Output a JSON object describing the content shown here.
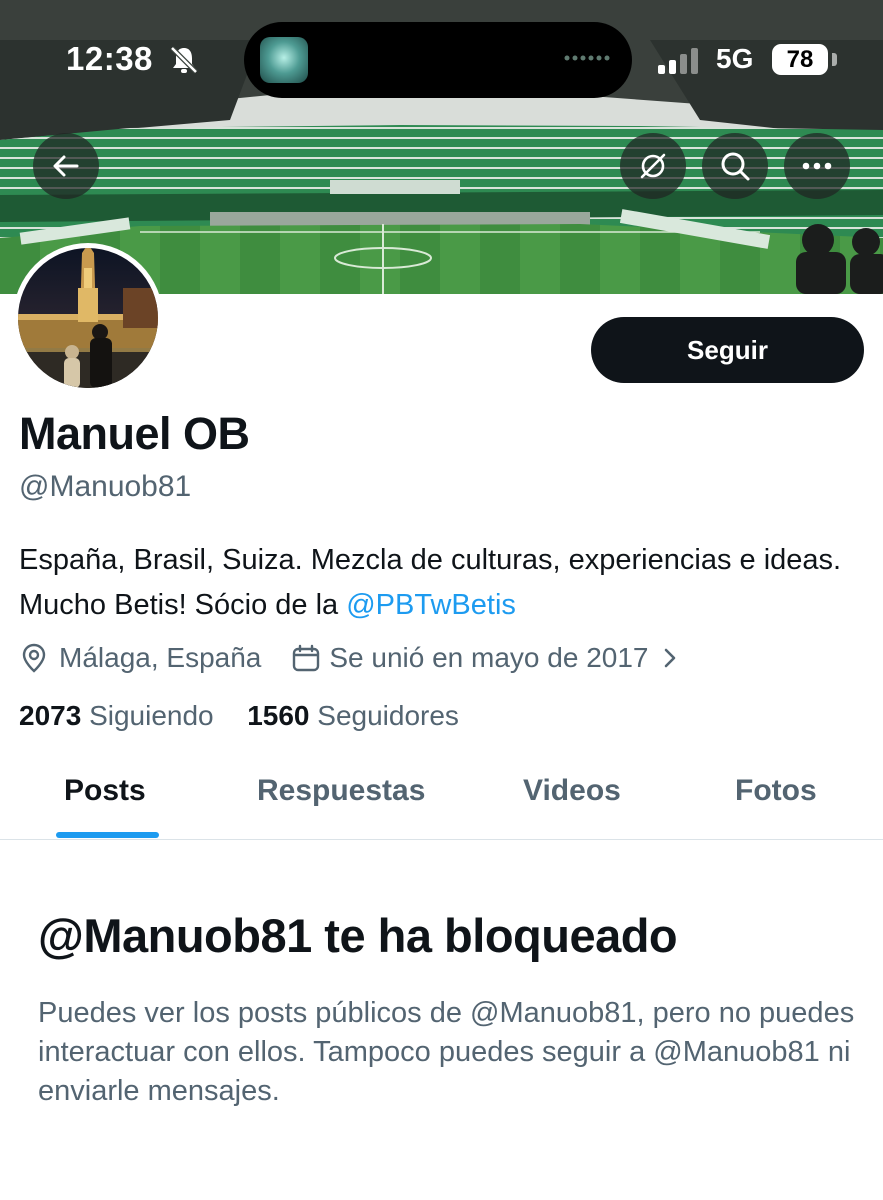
{
  "status_bar": {
    "time": "12:38",
    "network": "5G",
    "battery": "78"
  },
  "banner": {
    "image": "green football stadium with pitch and crowd"
  },
  "profile": {
    "follow_label": "Seguir",
    "display_name": "Manuel OB",
    "handle": "@Manuob81",
    "bio_text": "España, Brasil, Suiza. Mezcla de culturas, experiencias e ideas. Mucho Betis! Sócio de la ",
    "bio_link": "@PBTwBetis",
    "location": "Málaga, España",
    "joined": "Se unió en mayo de 2017",
    "following_count": "2073",
    "following_label": "Siguiendo",
    "followers_count": "1560",
    "followers_label": "Seguidores"
  },
  "tabs": [
    {
      "label": "Posts",
      "active": true
    },
    {
      "label": "Respuestas",
      "active": false
    },
    {
      "label": "Videos",
      "active": false
    },
    {
      "label": "Fotos",
      "active": false
    }
  ],
  "blocked": {
    "title": "@Manuob81 te ha bloqueado",
    "message": "Puedes ver los posts públicos de @Manuob81, pero no puedes interactuar con ellos. Tampoco puedes seguir a @Manuob81 ni enviarle mensajes."
  },
  "colors": {
    "accent": "#1d9bf0",
    "text_primary": "#0f1419",
    "text_secondary": "#536471",
    "pitch_green": "#3f8d3f"
  },
  "icons": [
    "back-arrow-icon",
    "rss-icon",
    "search-icon",
    "more-icon",
    "location-pin-icon",
    "calendar-icon",
    "chevron-right-icon",
    "bell-slash-icon",
    "cellular-signal-icon"
  ]
}
